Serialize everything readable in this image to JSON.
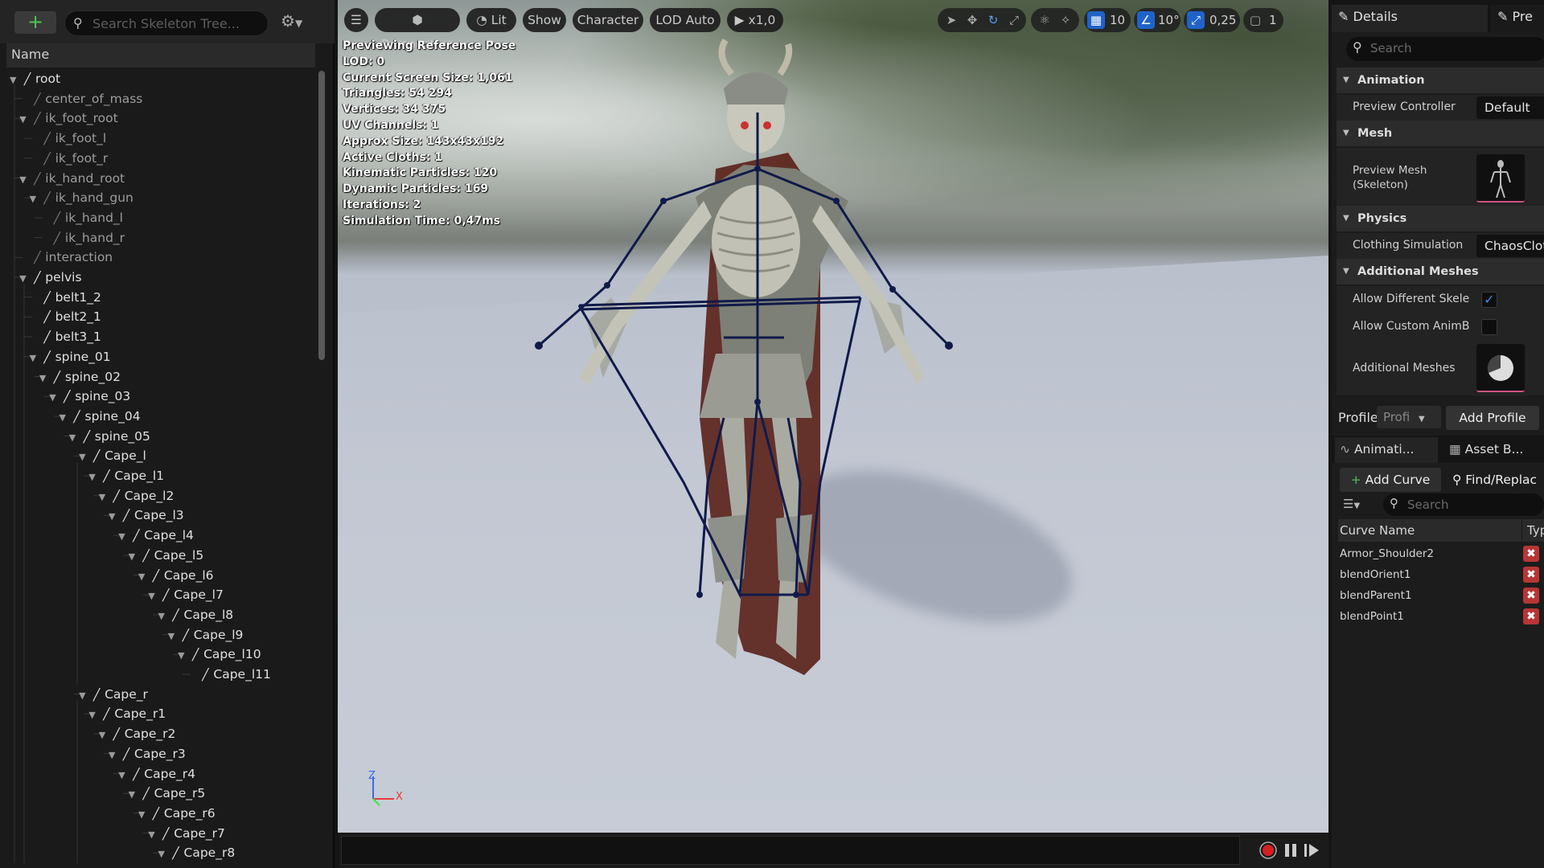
{
  "tree": {
    "search_placeholder": "Search Skeleton Tree...",
    "header": "Name",
    "bones": [
      {
        "label": "root",
        "depth": 0,
        "expand": "open",
        "dim": false
      },
      {
        "label": "center_of_mass",
        "depth": 1,
        "expand": "",
        "dim": true
      },
      {
        "label": "ik_foot_root",
        "depth": 1,
        "expand": "open",
        "dim": true
      },
      {
        "label": "ik_foot_l",
        "depth": 2,
        "expand": "",
        "dim": true
      },
      {
        "label": "ik_foot_r",
        "depth": 2,
        "expand": "",
        "dim": true
      },
      {
        "label": "ik_hand_root",
        "depth": 1,
        "expand": "open",
        "dim": true
      },
      {
        "label": "ik_hand_gun",
        "depth": 2,
        "expand": "open",
        "dim": true
      },
      {
        "label": "ik_hand_l",
        "depth": 3,
        "expand": "",
        "dim": true
      },
      {
        "label": "ik_hand_r",
        "depth": 3,
        "expand": "",
        "dim": true
      },
      {
        "label": "interaction",
        "depth": 1,
        "expand": "",
        "dim": true
      },
      {
        "label": "pelvis",
        "depth": 1,
        "expand": "open",
        "dim": false
      },
      {
        "label": "belt1_2",
        "depth": 2,
        "expand": "",
        "dim": false
      },
      {
        "label": "belt2_1",
        "depth": 2,
        "expand": "",
        "dim": false
      },
      {
        "label": "belt3_1",
        "depth": 2,
        "expand": "",
        "dim": false
      },
      {
        "label": "spine_01",
        "depth": 2,
        "expand": "open",
        "dim": false
      },
      {
        "label": "spine_02",
        "depth": 3,
        "expand": "open",
        "dim": false
      },
      {
        "label": "spine_03",
        "depth": 4,
        "expand": "open",
        "dim": false
      },
      {
        "label": "spine_04",
        "depth": 5,
        "expand": "open",
        "dim": false
      },
      {
        "label": "spine_05",
        "depth": 6,
        "expand": "open",
        "dim": false
      },
      {
        "label": "Cape_l",
        "depth": 7,
        "expand": "open",
        "dim": false
      },
      {
        "label": "Cape_l1",
        "depth": 8,
        "expand": "open",
        "dim": false
      },
      {
        "label": "Cape_l2",
        "depth": 9,
        "expand": "open",
        "dim": false
      },
      {
        "label": "Cape_l3",
        "depth": 10,
        "expand": "open",
        "dim": false
      },
      {
        "label": "Cape_l4",
        "depth": 11,
        "expand": "open",
        "dim": false
      },
      {
        "label": "Cape_l5",
        "depth": 12,
        "expand": "open",
        "dim": false
      },
      {
        "label": "Cape_l6",
        "depth": 13,
        "expand": "open",
        "dim": false
      },
      {
        "label": "Cape_l7",
        "depth": 14,
        "expand": "open",
        "dim": false
      },
      {
        "label": "Cape_l8",
        "depth": 15,
        "expand": "open",
        "dim": false
      },
      {
        "label": "Cape_l9",
        "depth": 16,
        "expand": "open",
        "dim": false
      },
      {
        "label": "Cape_l10",
        "depth": 17,
        "expand": "open",
        "dim": false
      },
      {
        "label": "Cape_l11",
        "depth": 18,
        "expand": "",
        "dim": false
      },
      {
        "label": "Cape_r",
        "depth": 7,
        "expand": "open",
        "dim": false
      },
      {
        "label": "Cape_r1",
        "depth": 8,
        "expand": "open",
        "dim": false
      },
      {
        "label": "Cape_r2",
        "depth": 9,
        "expand": "open",
        "dim": false
      },
      {
        "label": "Cape_r3",
        "depth": 10,
        "expand": "open",
        "dim": false
      },
      {
        "label": "Cape_r4",
        "depth": 11,
        "expand": "open",
        "dim": false
      },
      {
        "label": "Cape_r5",
        "depth": 12,
        "expand": "open",
        "dim": false
      },
      {
        "label": "Cape_r6",
        "depth": 13,
        "expand": "open",
        "dim": false
      },
      {
        "label": "Cape_r7",
        "depth": 14,
        "expand": "open",
        "dim": false
      },
      {
        "label": "Cape_r8",
        "depth": 15,
        "expand": "open",
        "dim": false
      }
    ]
  },
  "viewport": {
    "perspective": "Perspective",
    "lit": "Lit",
    "show": "Show",
    "character": "Character",
    "lod": "LOD Auto",
    "speed": "x1,0",
    "grid_snap": "10",
    "angle_snap": "10°",
    "scale_snap": "0,25",
    "camera_speed": "1",
    "stats": [
      "Previewing Reference Pose",
      "LOD: 0",
      "Current Screen Size: 1,061",
      "Triangles: 54 294",
      "Vertices: 34 375",
      "UV Channels: 1",
      "Approx Size: 143x43x192",
      "Active Cloths: 1",
      "Kinematic Particles: 120",
      "Dynamic Particles: 169",
      "Iterations: 2",
      "Simulation Time: 0,47ms"
    ],
    "axis_x": "X",
    "axis_z": "Z"
  },
  "details": {
    "tab_details": "Details",
    "tab_preview": "Pre",
    "search_placeholder": "Search",
    "sections": {
      "animation": "Animation",
      "mesh": "Mesh",
      "physics": "Physics",
      "additional_meshes": "Additional Meshes"
    },
    "preview_controller_label": "Preview Controller",
    "preview_controller_value": "Default",
    "preview_mesh_label_1": "Preview Mesh",
    "preview_mesh_label_2": "(Skeleton)",
    "clothing_simulation_label": "Clothing Simulation",
    "clothing_simulation_value": "ChaosCloth",
    "allow_different_label": "Allow Different Skele",
    "allow_custom_label": "Allow Custom AnimB",
    "allow_different_checked": true,
    "allow_custom_checked": false,
    "additional_meshes_label": "Additional Meshes",
    "profile_label": "Profile",
    "profile_value": "Profi",
    "add_profile": "Add Profile",
    "tab_anim_curves": "Animati...",
    "tab_asset_browser": "Asset B...",
    "add_curve": "Add Curve",
    "find_replace": "Find/Replac",
    "curve_search_placeholder": "Search",
    "curve_name_header": "Curve Name",
    "type_header": "Typ",
    "curves": [
      "Armor_Shoulder2",
      "blendOrient1",
      "blendParent1",
      "blendPoint1"
    ]
  },
  "colors": {
    "accent_blue": "#1f63c9",
    "skeleton_lines": "#101a4a",
    "record_red": "#d42020"
  }
}
